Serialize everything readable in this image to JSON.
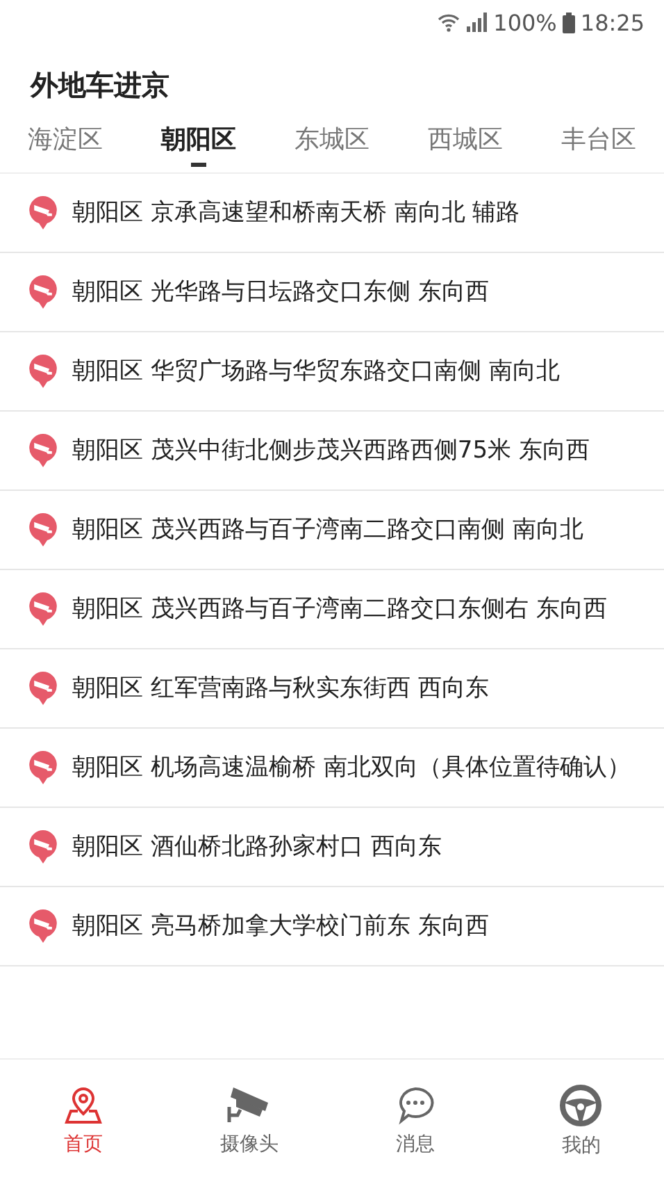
{
  "status_bar": {
    "battery": "100%",
    "time": "18:25"
  },
  "header": {
    "title": "外地车进京"
  },
  "tabs": [
    {
      "label": "海淀区",
      "selected": false
    },
    {
      "label": "朝阳区",
      "selected": true
    },
    {
      "label": "东城区",
      "selected": false
    },
    {
      "label": "西城区",
      "selected": false
    },
    {
      "label": "丰台区",
      "selected": false
    }
  ],
  "cameras": [
    {
      "text": "朝阳区 京承高速望和桥南天桥 南向北 辅路"
    },
    {
      "text": "朝阳区 光华路与日坛路交口东侧 东向西"
    },
    {
      "text": "朝阳区 华贸广场路与华贸东路交口南侧 南向北"
    },
    {
      "text": "朝阳区 茂兴中街北侧步茂兴西路西侧75米 东向西"
    },
    {
      "text": "朝阳区 茂兴西路与百子湾南二路交口南侧 南向北"
    },
    {
      "text": "朝阳区 茂兴西路与百子湾南二路交口东侧右 东向西"
    },
    {
      "text": "朝阳区 红军营南路与秋实东街西 西向东"
    },
    {
      "text": "朝阳区 机场高速温榆桥 南北双向（具体位置待确认）"
    },
    {
      "text": "朝阳区 酒仙桥北路孙家村口 西向东"
    },
    {
      "text": "朝阳区 亮马桥加拿大学校门前东 东向西"
    }
  ],
  "nav": [
    {
      "label": "首页",
      "kind": "home",
      "selected": true
    },
    {
      "label": "摄像头",
      "kind": "camera",
      "selected": false
    },
    {
      "label": "消息",
      "kind": "message",
      "selected": false
    },
    {
      "label": "我的",
      "kind": "wheel",
      "selected": false
    }
  ]
}
